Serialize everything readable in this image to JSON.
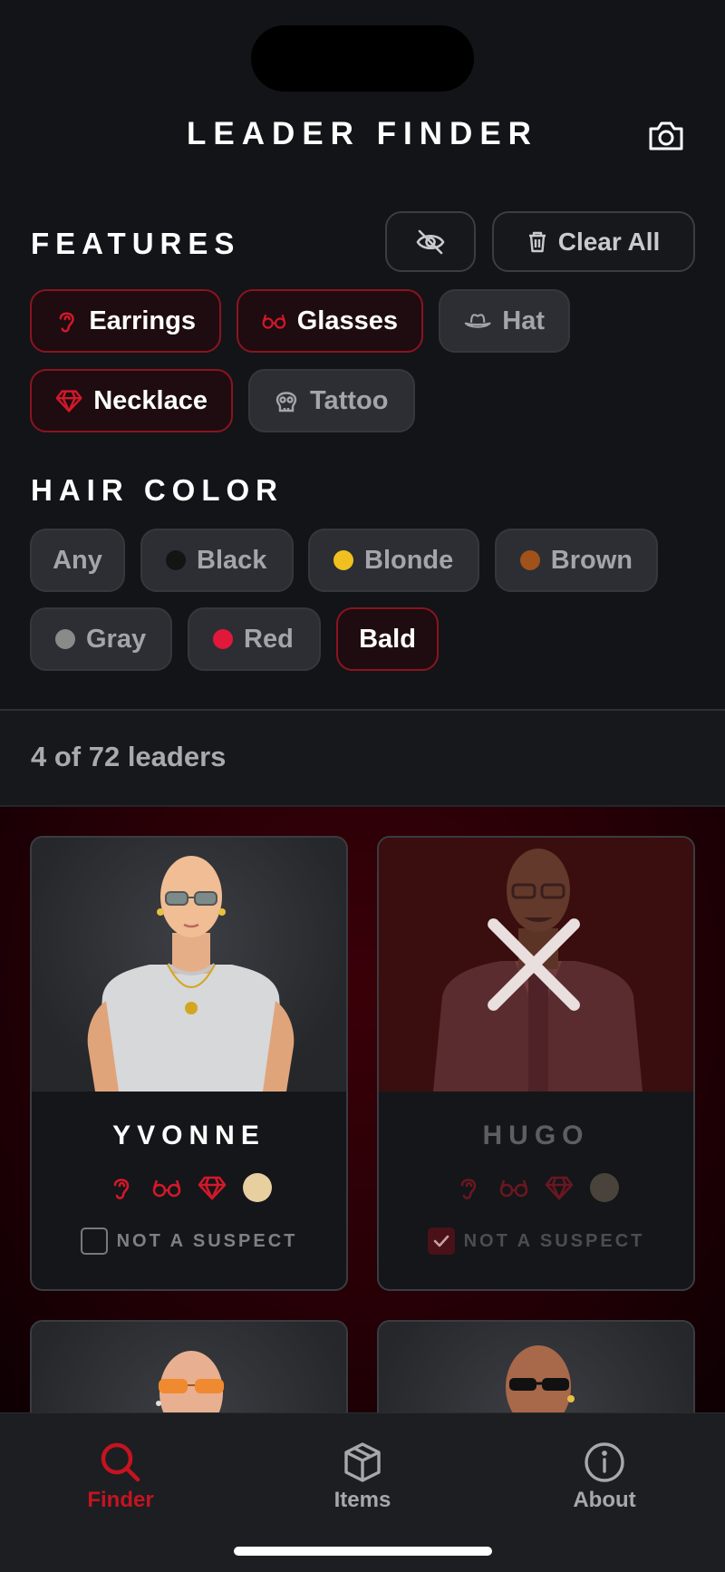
{
  "header": {
    "title": "LEADER FINDER",
    "camera_icon": "camera-icon"
  },
  "features": {
    "heading": "FEATURES",
    "hide_icon": "eye-slash-icon",
    "clear_all_label": "Clear All",
    "chips": [
      {
        "label": "Earrings",
        "icon": "ear-icon",
        "active": true
      },
      {
        "label": "Glasses",
        "icon": "glasses-icon",
        "active": true
      },
      {
        "label": "Hat",
        "icon": "hat-icon",
        "active": false
      },
      {
        "label": "Necklace",
        "icon": "gem-icon",
        "active": true
      },
      {
        "label": "Tattoo",
        "icon": "skull-icon",
        "active": false
      }
    ]
  },
  "hair_color": {
    "heading": "HAIR COLOR",
    "options": [
      {
        "label": "Any",
        "color": null,
        "selected": false
      },
      {
        "label": "Black",
        "color": "#141414",
        "selected": false
      },
      {
        "label": "Blonde",
        "color": "#f0c020",
        "selected": false
      },
      {
        "label": "Brown",
        "color": "#a0521a",
        "selected": false
      },
      {
        "label": "Gray",
        "color": "#8a8a8a",
        "selected": false
      },
      {
        "label": "Red",
        "color": "#e0183a",
        "selected": false
      },
      {
        "label": "Bald",
        "color": null,
        "selected": true
      }
    ]
  },
  "results": {
    "count_text": "4 of 72 leaders",
    "cards": [
      {
        "name": "YVONNE",
        "eliminated": false,
        "hair_color": "#e8cfa0",
        "not_suspect_label": "NOT A SUSPECT",
        "not_suspect_checked": false
      },
      {
        "name": "HUGO",
        "eliminated": true,
        "hair_color": "#8a7a66",
        "not_suspect_label": "NOT A SUSPECT",
        "not_suspect_checked": true
      }
    ]
  },
  "tabs": [
    {
      "label": "Finder",
      "icon": "search-icon",
      "active": true
    },
    {
      "label": "Items",
      "icon": "box-icon",
      "active": false
    },
    {
      "label": "About",
      "icon": "info-icon",
      "active": false
    }
  ],
  "colors": {
    "accent": "#c4141f",
    "background": "#121418"
  }
}
